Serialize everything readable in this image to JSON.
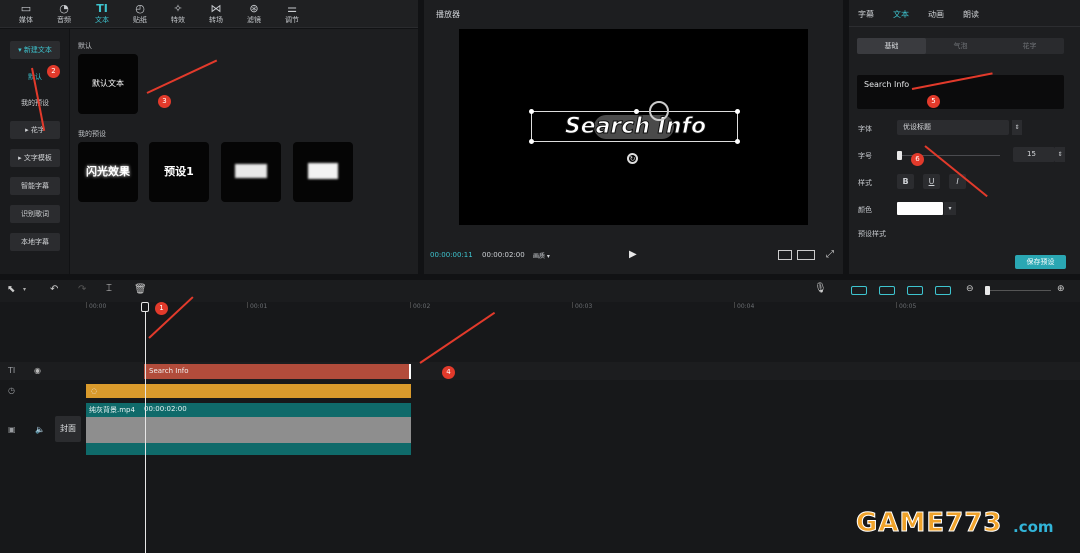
{
  "toolbar": {
    "items": [
      {
        "label": "媒体",
        "icon": "media-icon"
      },
      {
        "label": "音频",
        "icon": "audio-icon"
      },
      {
        "label": "文本",
        "icon": "text-icon",
        "glyph": "TI"
      },
      {
        "label": "贴纸",
        "icon": "sticker-icon"
      },
      {
        "label": "特效",
        "icon": "effects-icon"
      },
      {
        "label": "转场",
        "icon": "transition-icon"
      },
      {
        "label": "滤镜",
        "icon": "filter-icon"
      },
      {
        "label": "调节",
        "icon": "adjust-icon"
      }
    ]
  },
  "sidebar": {
    "new_text": "▾ 新建文本",
    "default": "默认",
    "my_presets": "我的预设",
    "huazi": "▸ 花字",
    "text_template": "▸ 文字模板",
    "smart_caption": "智能字幕",
    "recognize_lyrics": "识别歌词",
    "local_caption": "本地字幕"
  },
  "presets": {
    "default_title": "默认",
    "default_card": "默认文本",
    "my_presets_title": "我的预设",
    "cards": [
      "闪光效果",
      "预设1"
    ]
  },
  "player": {
    "title": "播放器",
    "canvas_text": "Search Info",
    "time_current": "00:00:00:11",
    "time_total": "00:00:02:00",
    "quality": "画质 ▾"
  },
  "inspector": {
    "tabs": [
      "字幕",
      "文本",
      "动画",
      "朗读"
    ],
    "subtabs": [
      "基础",
      "气泡",
      "花字"
    ],
    "text_value": "Search Info",
    "font_label": "字体",
    "font_value": "优设标题",
    "size_label": "字号",
    "size_value": "15",
    "style_label": "样式",
    "style_buttons": [
      "B",
      "U",
      "I"
    ],
    "color_label": "颜色",
    "preset_style_label": "预设样式",
    "save_preset": "保存预设"
  },
  "timeline": {
    "ruler": [
      "00:00",
      "00:01",
      "00:02",
      "00:03",
      "00:04",
      "00:05"
    ],
    "text_clip": "Search Info",
    "video_clip_name": "纯灰背景.mp4",
    "video_clip_duration": "00:00:02:00",
    "cover_label": "封面",
    "track_icon_text": "TI"
  },
  "annotations": [
    "1",
    "2",
    "3",
    "4",
    "5",
    "6"
  ],
  "watermark": {
    "main": "GAME773",
    "suffix": ".com"
  },
  "colors": {
    "accent": "#3ec4cf",
    "text_clip": "#b24c3b",
    "audio_clip": "#d99a2c",
    "video_clip": "#0f6a6a",
    "arrow": "#e23a2b"
  }
}
